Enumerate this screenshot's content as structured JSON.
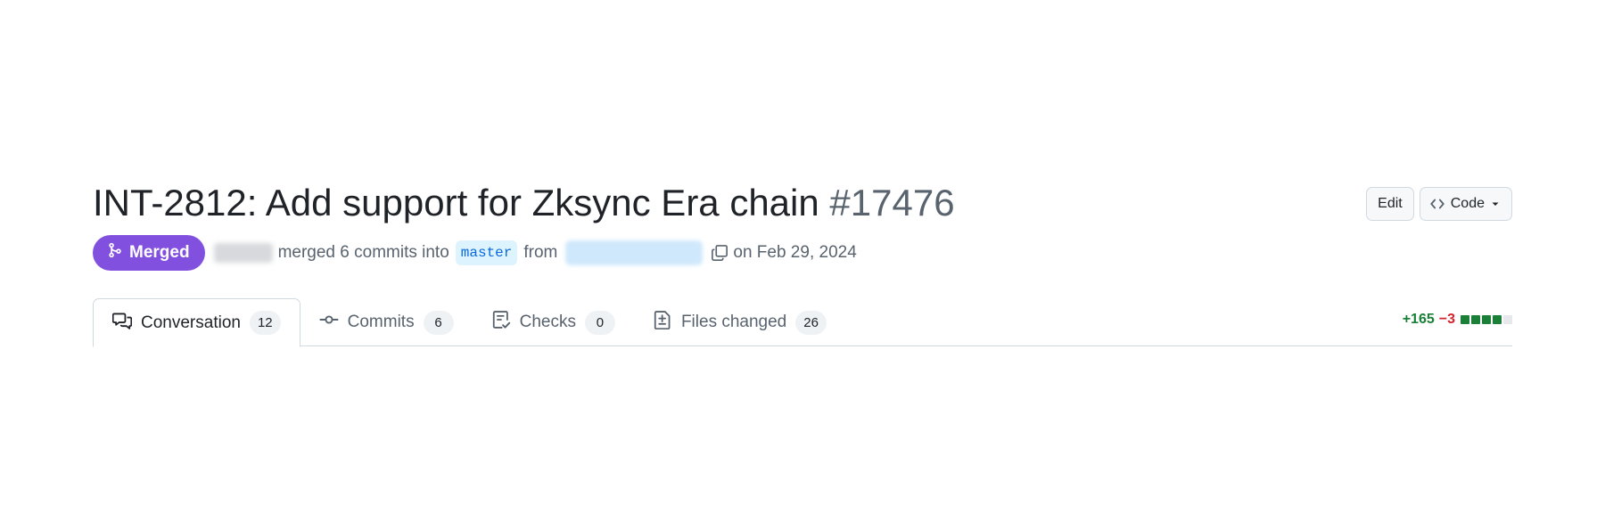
{
  "pr": {
    "title": "INT-2812: Add support for Zksync Era chain",
    "number": "#17476"
  },
  "actions": {
    "edit_label": "Edit",
    "code_label": "Code"
  },
  "status": {
    "badge_label": "Merged",
    "merged_text": "merged 6 commits into",
    "base_branch": "master",
    "from_text": "from",
    "date_text": "on Feb 29, 2024"
  },
  "tabs": [
    {
      "label": "Conversation",
      "count": "12",
      "icon": "comment-discussion-icon"
    },
    {
      "label": "Commits",
      "count": "6",
      "icon": "git-commit-icon"
    },
    {
      "label": "Checks",
      "count": "0",
      "icon": "checklist-icon"
    },
    {
      "label": "Files changed",
      "count": "26",
      "icon": "file-diff-icon"
    }
  ],
  "diffstat": {
    "additions": "+165",
    "deletions": "−3",
    "blocks": [
      "green",
      "green",
      "green",
      "green",
      "neutral"
    ]
  },
  "colors": {
    "merged": "#8250df",
    "branch_bg": "#ddf4ff",
    "branch_text": "#0969da",
    "addition": "#1a7f37",
    "deletion": "#d1242f",
    "block_green": "#1a7f37",
    "block_neutral": "#e6e8eb"
  }
}
